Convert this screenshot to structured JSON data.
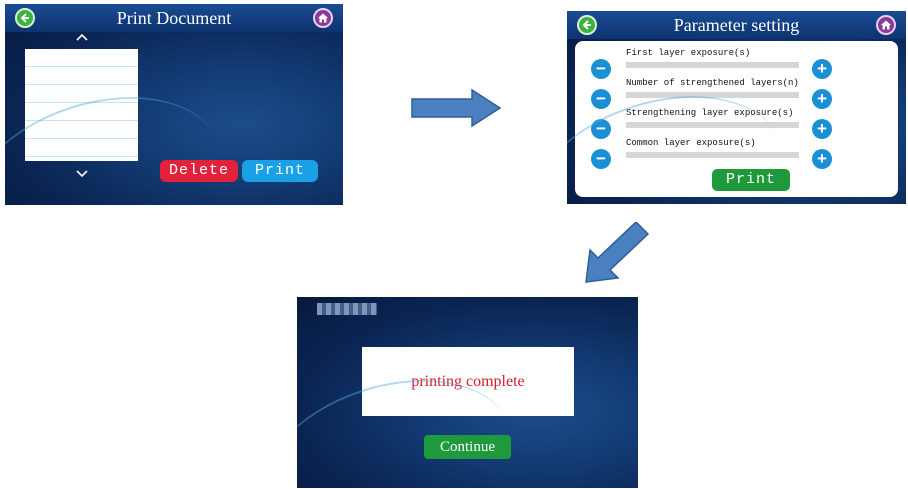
{
  "screens": {
    "print_document": {
      "title": "Print Document",
      "back_icon": "back-arrow-icon",
      "home_icon": "home-icon",
      "file_list_rows": [
        "",
        "",
        "",
        "",
        "",
        ""
      ],
      "scroll_up": "^",
      "scroll_down": "v",
      "delete_label": "Delete",
      "print_label": "Print"
    },
    "parameter_setting": {
      "title": "Parameter setting",
      "parameters": [
        {
          "label": "First layer exposure(s)"
        },
        {
          "label": "Number of strengthened layers(n)"
        },
        {
          "label": "Strengthening layer exposure(s)"
        },
        {
          "label": "Common layer exposure(s)"
        }
      ],
      "minus_symbol": "−",
      "plus_symbol": "+",
      "print_label": "Print"
    },
    "print_complete": {
      "message": "printing complete",
      "continue_label": "Continue"
    }
  },
  "flow_arrows": [
    "right",
    "down-left"
  ],
  "colors": {
    "delete": "#e2213a",
    "print_blue": "#1aa0e6",
    "print_green": "#1e9a3c",
    "message_red": "#d0202a",
    "arrow": "#4a7fc0"
  }
}
